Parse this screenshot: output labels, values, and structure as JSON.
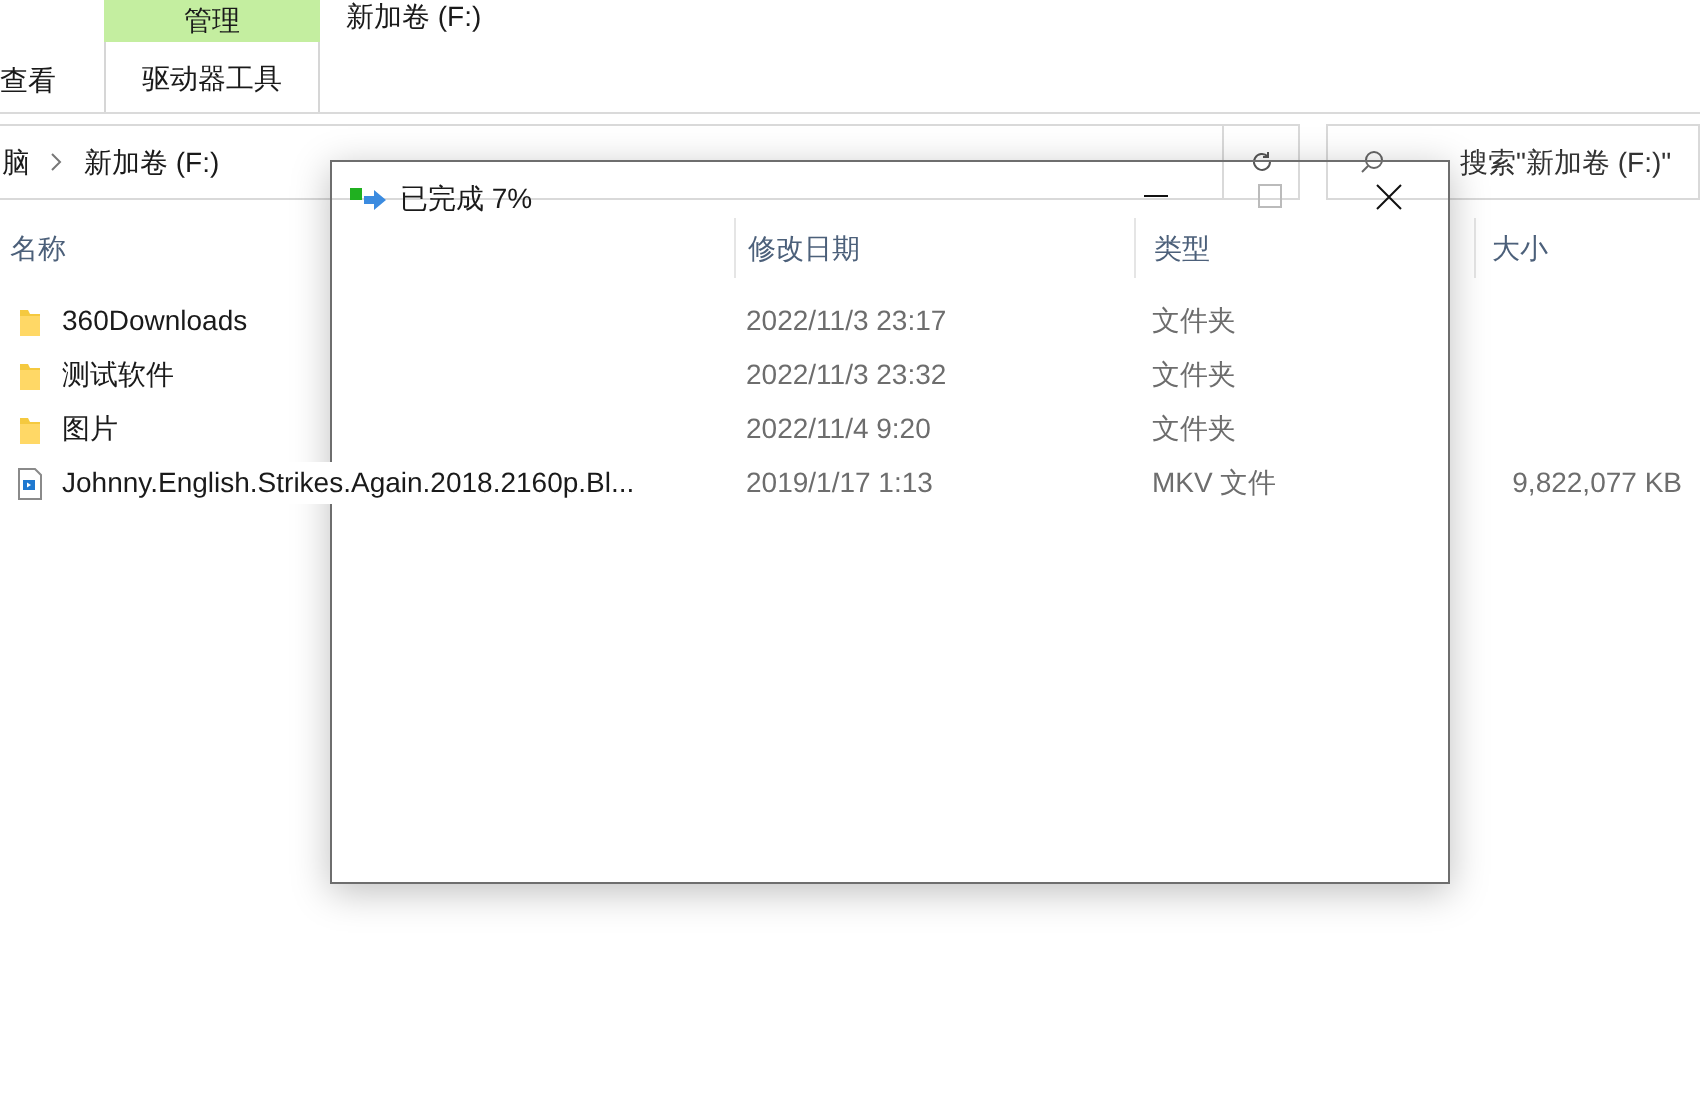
{
  "ribbon": {
    "view_tab": "查看",
    "context_group": "管理",
    "context_tab": "驱动器工具"
  },
  "window_title": "新加卷 (F:)",
  "breadcrumb": [
    "脑",
    "新加卷 (F:)"
  ],
  "search": {
    "placeholder": "搜索\"新加卷 (F:)\""
  },
  "columns": [
    "名称",
    "修改日期",
    "类型",
    "大小"
  ],
  "files": [
    {
      "kind": "folder",
      "name": "360Downloads",
      "modified": "2022/11/3 23:17",
      "type": "文件夹"
    },
    {
      "kind": "folder",
      "name": "测试软件",
      "modified": "2022/11/3 23:32",
      "type": "文件夹"
    },
    {
      "kind": "folder",
      "name": "图片",
      "modified": "2022/11/4 9:20",
      "type": "文件夹"
    },
    {
      "kind": "video",
      "name": "Johnny.English.Strikes.Again.2018.2160p.Bl...",
      "modified": "2019/1/17 1:13",
      "type": "MKV 文件",
      "size": "9,822,077 KB"
    }
  ],
  "dialog": {
    "title": "已完成 7%"
  }
}
